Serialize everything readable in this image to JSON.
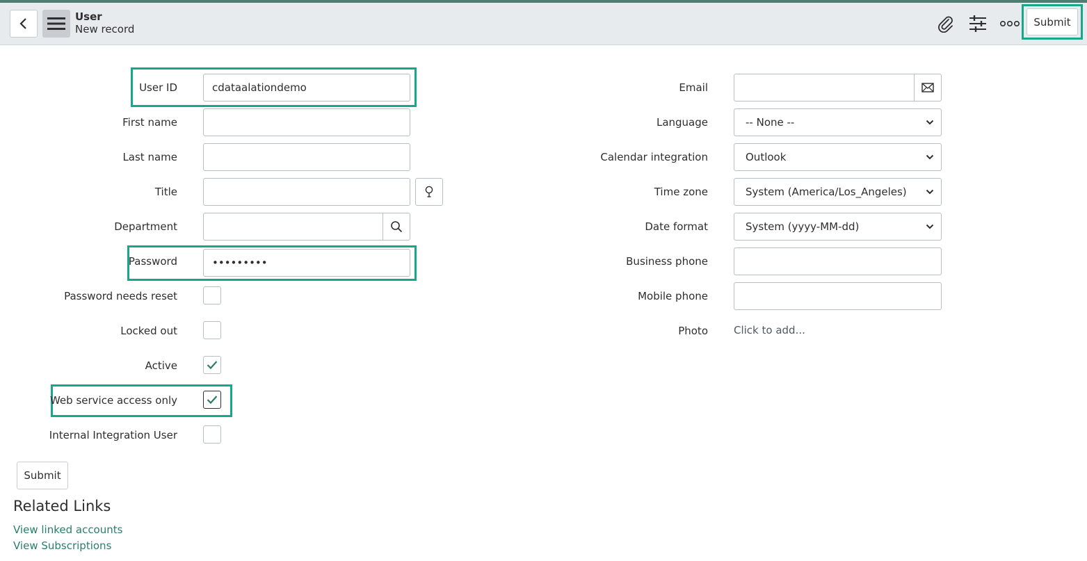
{
  "header": {
    "title": "User",
    "subtitle": "New record",
    "submit_label": "Submit"
  },
  "left_fields": {
    "user_id": {
      "label": "User ID",
      "value": "cdataalationdemo"
    },
    "first_name": {
      "label": "First name",
      "value": ""
    },
    "last_name": {
      "label": "Last name",
      "value": ""
    },
    "title": {
      "label": "Title",
      "value": ""
    },
    "department": {
      "label": "Department",
      "value": ""
    },
    "password": {
      "label": "Password",
      "value": "•••••••••"
    },
    "password_needs_reset": {
      "label": "Password needs reset",
      "checked": false
    },
    "locked_out": {
      "label": "Locked out",
      "checked": false
    },
    "active": {
      "label": "Active",
      "checked": true
    },
    "web_service_access_only": {
      "label": "Web service access only",
      "checked": true
    },
    "internal_integration_user": {
      "label": "Internal Integration User",
      "checked": false
    }
  },
  "right_fields": {
    "email": {
      "label": "Email",
      "value": ""
    },
    "language": {
      "label": "Language",
      "value": "-- None --"
    },
    "calendar_integration": {
      "label": "Calendar integration",
      "value": "Outlook"
    },
    "time_zone": {
      "label": "Time zone",
      "value": "System (America/Los_Angeles)"
    },
    "date_format": {
      "label": "Date format",
      "value": "System (yyyy-MM-dd)"
    },
    "business_phone": {
      "label": "Business phone",
      "value": ""
    },
    "mobile_phone": {
      "label": "Mobile phone",
      "value": ""
    },
    "photo": {
      "label": "Photo",
      "value": "Click to add..."
    }
  },
  "footer": {
    "submit_label": "Submit",
    "related_links_title": "Related Links",
    "links": [
      "View linked accounts",
      "View Subscriptions"
    ]
  },
  "colors": {
    "accent": "#17a88c",
    "link": "#2a7d6a",
    "header_bg": "#e8ebee"
  },
  "icons": {
    "back": "chevron-left-icon",
    "menu": "hamburger-menu-icon",
    "attach": "paperclip-icon",
    "personalize": "sliders-icon",
    "more": "more-options-icon",
    "email": "envelope-icon",
    "title_suggest": "lightbulb-icon",
    "department_lookup": "search-icon",
    "check": "checkmark-icon",
    "dropdown": "chevron-down-icon"
  }
}
